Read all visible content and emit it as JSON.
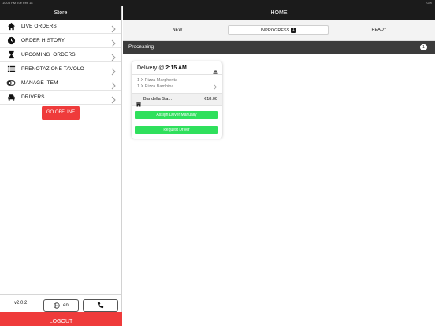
{
  "statusbar": {
    "time": "10:08 PM Tue Feb 18",
    "battery": "72%"
  },
  "sidebar": {
    "title": "Store",
    "items": [
      {
        "label": "LIVE ORDERS",
        "icon": "home-icon"
      },
      {
        "label": "ORDER HISTORY",
        "icon": "clock-icon"
      },
      {
        "label": "UPCOMING_ORDERS",
        "icon": "hourglass-icon"
      },
      {
        "label": "PRENOTAZIONE TAVOLO",
        "icon": "list-icon"
      },
      {
        "label": "MANAGE ITEM",
        "icon": "toggle-icon"
      },
      {
        "label": "DRIVERS",
        "icon": "car-icon"
      }
    ],
    "offline_button": "GO OFFLINE",
    "version": "v2.0.2",
    "language": "en",
    "logout": "LOGOUT"
  },
  "main": {
    "title": "HOME",
    "tabs": {
      "new": "NEW",
      "inprogress": "INPROGRESS",
      "inprogress_count": "1",
      "ready": "READY"
    },
    "section": {
      "label": "Processing",
      "count": "1"
    },
    "order": {
      "type": "Delivery @ ",
      "time": "2:15 AM",
      "items": [
        "1 X Pizza Margherita",
        "1 X Pizza Bambina"
      ],
      "store": "Bar della Sta...",
      "price": "€18.00",
      "assign_label": "Assign Driver Manually",
      "request_label": "Request Driver"
    }
  },
  "colors": {
    "accent_red": "#ef3b3b",
    "green": "#2fe05c",
    "header_dark": "#1b1b1b",
    "section_dark": "#3b3b3b"
  }
}
